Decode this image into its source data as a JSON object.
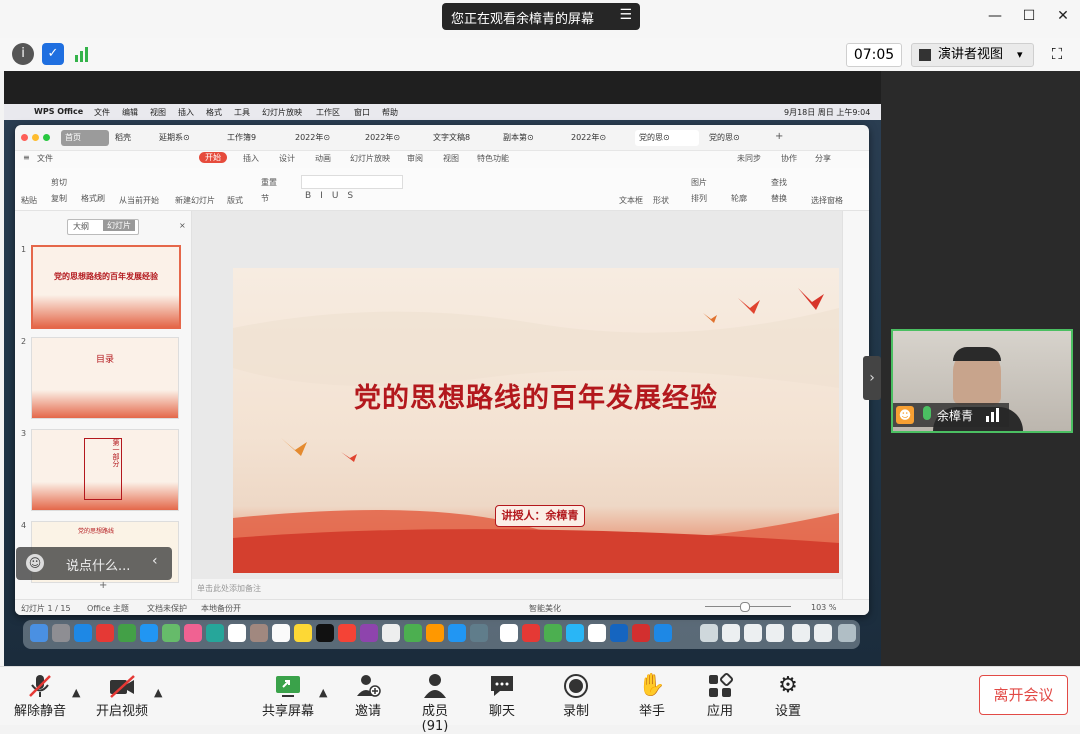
{
  "banner": {
    "title": "您正在观看余樟青的屏幕",
    "menu_icon": "list-icon"
  },
  "window_controls": {
    "minimize": "—",
    "maximize": "☐",
    "close": "✕"
  },
  "toolbar": {
    "timer": "07:05",
    "view_mode": "演讲者视图",
    "view_caret": "▾"
  },
  "mac": {
    "app": "WPS Office",
    "menus": [
      "文件",
      "编辑",
      "视图",
      "插入",
      "格式",
      "工具",
      "幻灯片放映",
      "工作区",
      "窗口",
      "帮助"
    ],
    "clock": "9月18日 周日 上午9:04"
  },
  "wps": {
    "tabs": [
      "首页",
      "稻壳",
      "延期系⊙",
      "工作簿9",
      "2022年⊙",
      "2022年⊙",
      "文字文稿8",
      "副本第⊙",
      "2022年⊙",
      "党的思⊙",
      "党的思⊙"
    ],
    "menu_items": [
      "文件",
      "开始",
      "插入",
      "设计",
      "动画",
      "幻灯片放映",
      "审阅",
      "视图",
      "特色功能"
    ],
    "menu_right": [
      "未同步",
      "协作",
      "分享"
    ],
    "ribbon": [
      "粘贴",
      "剪切",
      "复制",
      "格式刷",
      "从当前开始",
      "新建幻灯片",
      "版式",
      "节",
      "重置",
      "文本框",
      "形状",
      "图片",
      "排列",
      "轮廓",
      "查找",
      "替换",
      "选择窗格"
    ],
    "panel_tabs": [
      "大纲",
      "幻灯片"
    ],
    "thumb_titles": [
      "党的思想路线的百年发展经验",
      "目录",
      "第一部分",
      "党的思想路线"
    ],
    "notes_hint": "单击此处添加备注",
    "status": {
      "slide": "幻灯片 1 / 15",
      "theme": "Office 主题",
      "protect": "文档未保护",
      "backup": "本地备份开",
      "beautify": "智能美化",
      "zoom": "103 %"
    }
  },
  "slide": {
    "title": "党的思想路线的百年发展经验",
    "presenter": "讲授人：余樟青"
  },
  "chat": {
    "placeholder": "说点什么...",
    "emoji_icon": "smile-icon"
  },
  "video": {
    "name": "余樟青"
  },
  "bottom": {
    "items": [
      {
        "label": "解除静音",
        "icon": "mic-muted-icon"
      },
      {
        "label": "开启视频",
        "icon": "camera-off-icon"
      },
      {
        "label": "共享屏幕",
        "icon": "share-screen-icon"
      },
      {
        "label": "邀请",
        "icon": "invite-icon"
      },
      {
        "label": "成员(91)",
        "icon": "members-icon"
      },
      {
        "label": "聊天",
        "icon": "chat-icon"
      },
      {
        "label": "录制",
        "icon": "record-icon"
      },
      {
        "label": "举手",
        "icon": "raise-hand-icon"
      },
      {
        "label": "应用",
        "icon": "apps-icon"
      },
      {
        "label": "设置",
        "icon": "settings-icon"
      }
    ],
    "leave": "离开会议"
  },
  "colors": {
    "accent_red": "#b3181d",
    "green": "#4bbf62",
    "leave": "#e24a46"
  }
}
